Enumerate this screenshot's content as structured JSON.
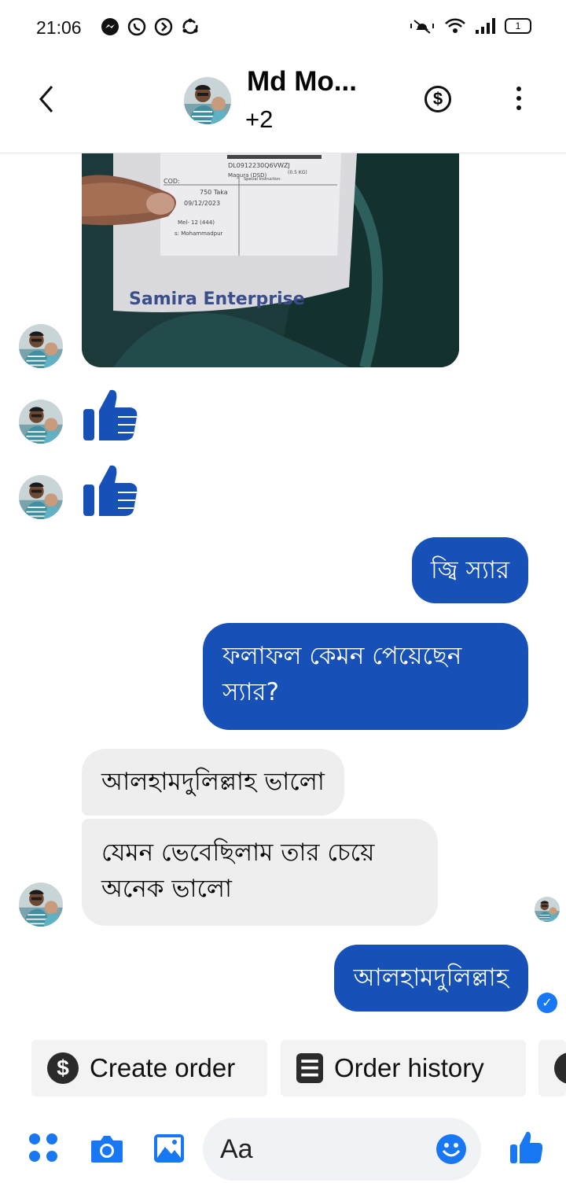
{
  "status_bar": {
    "time": "21:06",
    "left_icons": [
      "messenger-icon",
      "whatsapp-icon",
      "whatsapp-business-icon",
      "sync-icon"
    ],
    "right_icons": [
      "vibrate-icon",
      "wifi-icon",
      "signal-icon",
      "battery-icon"
    ],
    "battery_level": "1"
  },
  "header": {
    "contact_name": "Md Mo...",
    "participants_extra": "+2",
    "payment_icon": "dollar-circle-icon",
    "menu_icon": "more-vertical-icon"
  },
  "photo_message": {
    "label_line_1": "DL0912230Q6VWZJ",
    "label_line_2": "Magura (DSD)",
    "label_weight": "(0.5 KG)",
    "label_cod_key": "COD:",
    "label_cod_value": "750 Taka",
    "label_date": "09/12/2023",
    "label_route": "Mel- 12 (444)",
    "label_area": "s: Mohammadpur",
    "label_instructions": "Special Instruction:",
    "label_brand": "Samira Enterprise"
  },
  "messages": [
    {
      "direction": "outgoing",
      "text": "জ্বি স্যার"
    },
    {
      "direction": "outgoing",
      "text": "ফলাফল কেমন পেয়েছেন স্যার?"
    },
    {
      "direction": "incoming",
      "text": "আলহামদুলিল্লাহ ভালো"
    },
    {
      "direction": "incoming",
      "text": "যেমন ভেবেছিলাম তার চেয়ে অনেক ভালো"
    },
    {
      "direction": "outgoing",
      "text": "আলহামদুলিল্লাহ"
    }
  ],
  "quick_replies": [
    {
      "label": "Create order",
      "icon": "dollar-icon",
      "icon_glyph": "$"
    },
    {
      "label": "Order history",
      "icon": "order-list-icon",
      "icon_glyph": "☰"
    }
  ],
  "composer": {
    "placeholder": "Aa",
    "icons": [
      "apps-menu-icon",
      "camera-icon",
      "gallery-icon",
      "emoji-icon",
      "like-icon"
    ]
  },
  "colors": {
    "outgoing_bubble": "#1751b8",
    "incoming_bubble": "#eeeeee",
    "accent": "#1877f2",
    "like": "#1751b8"
  }
}
